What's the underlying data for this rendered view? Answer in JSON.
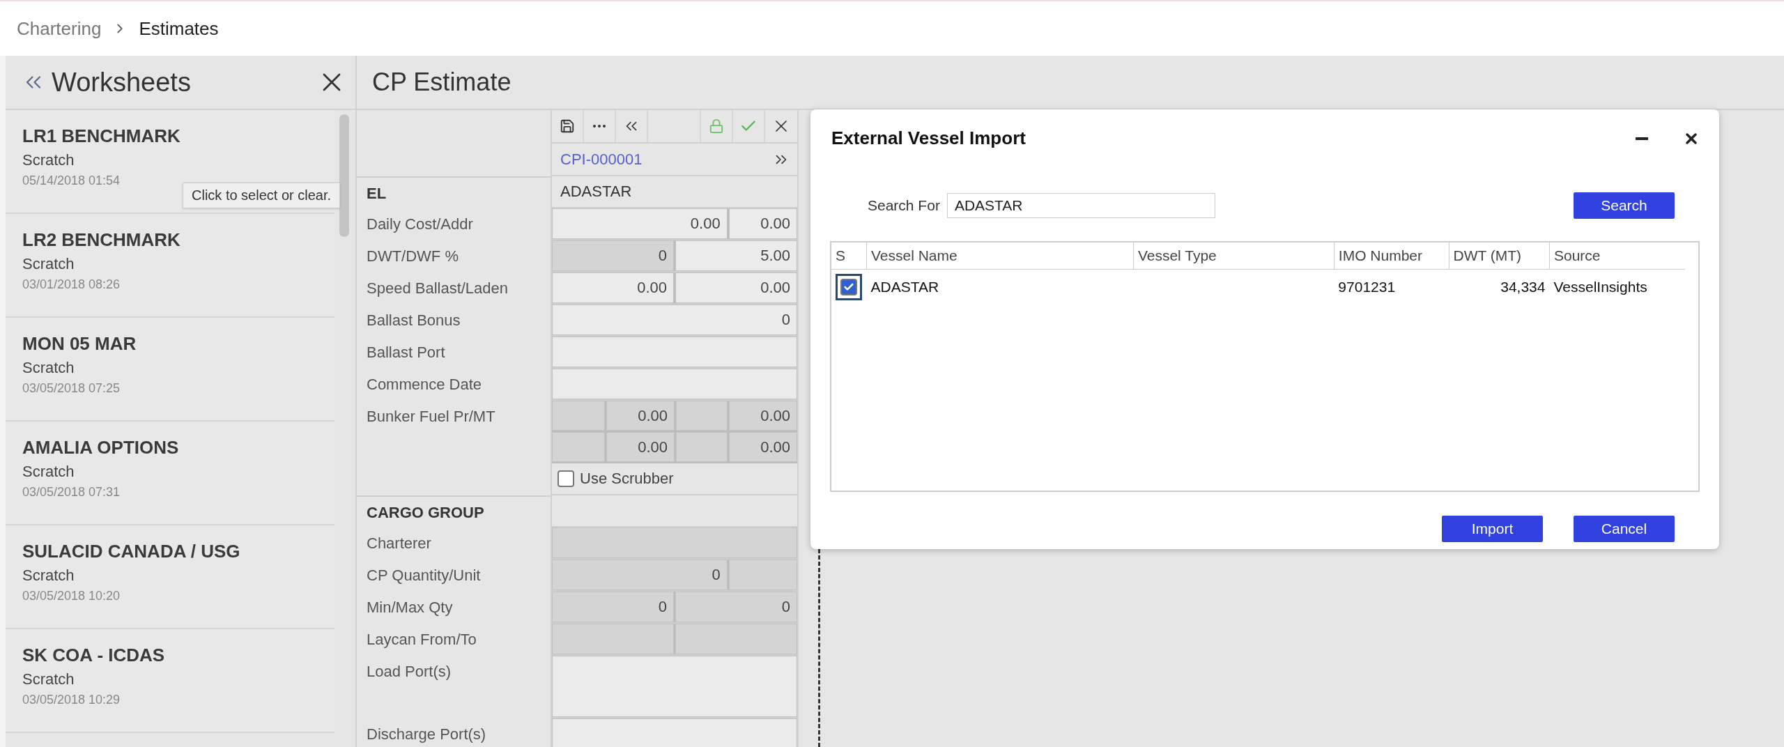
{
  "breadcrumb": [
    {
      "label": "Chartering",
      "current": false
    },
    {
      "label": "Estimates",
      "current": true
    }
  ],
  "sidebar": {
    "title": "Worksheets",
    "items": [
      {
        "name": "LR1 BENCHMARK",
        "type": "Scratch",
        "date": "05/14/2018 01:54"
      },
      {
        "name": "LR2 BENCHMARK",
        "type": "Scratch",
        "date": "03/01/2018 08:26"
      },
      {
        "name": "MON 05 MAR",
        "type": "Scratch",
        "date": "03/05/2018 07:25"
      },
      {
        "name": "AMALIA OPTIONS",
        "type": "Scratch",
        "date": "03/05/2018 07:31"
      },
      {
        "name": "SULACID CANADA / USG",
        "type": "Scratch",
        "date": "03/05/2018 10:20"
      },
      {
        "name": "SK COA - ICDAS",
        "type": "Scratch",
        "date": "03/05/2018 10:29"
      }
    ]
  },
  "tooltip": "Click to select or clear.",
  "estimate": {
    "title": "CP Estimate",
    "record_id": "CPI-000001",
    "sections": [
      {
        "title": "EL",
        "value": "ADASTAR",
        "rows": [
          {
            "label": "Daily Cost/Addr",
            "kind": "wide-narrow",
            "cells": [
              {
                "value": "0.00",
                "shaded": false
              },
              {
                "value": "0.00",
                "shaded": false
              }
            ]
          },
          {
            "label": "DWT/DWF %",
            "kind": "split",
            "cells": [
              {
                "value": "0",
                "shaded": true
              },
              {
                "value": "5.00",
                "shaded": false
              }
            ]
          },
          {
            "label": "Speed Ballast/Laden",
            "kind": "split",
            "cells": [
              {
                "value": "0.00",
                "shaded": false
              },
              {
                "value": "0.00",
                "shaded": false
              }
            ]
          },
          {
            "label": "Ballast Bonus",
            "kind": "single",
            "cells": [
              {
                "value": "0",
                "shaded": false
              }
            ]
          },
          {
            "label": "Ballast Port",
            "kind": "single",
            "cells": [
              {
                "shaded": false
              }
            ]
          },
          {
            "label": "Commence Date",
            "kind": "single",
            "cells": [
              {
                "shaded": false
              }
            ]
          },
          {
            "label": "Bunker Fuel Pr/MT",
            "kind": "quad",
            "cells": [
              {
                "shaded": true
              },
              {
                "value": "0.00",
                "shaded": true
              },
              {
                "shaded": true
              },
              {
                "value": "0.00",
                "shaded": true
              },
              {
                "shaded": true
              },
              {
                "value": "0.00",
                "shaded": true
              },
              {
                "shaded": true
              },
              {
                "value": "0.00",
                "shaded": true
              }
            ]
          },
          {
            "kind": "checkbox",
            "option": "Use Scrubber",
            "checked": false
          }
        ]
      },
      {
        "title": "CARGO GROUP",
        "rows": [
          {
            "label": "Charterer",
            "kind": "single",
            "cells": [
              {
                "shaded": true
              }
            ]
          },
          {
            "label": "CP Quantity/Unit",
            "kind": "wide-narrow",
            "cells": [
              {
                "value": "0",
                "shaded": true
              },
              {
                "shaded": true
              }
            ]
          },
          {
            "label": "Min/Max Qty",
            "kind": "split",
            "cells": [
              {
                "value": "0",
                "shaded": true
              },
              {
                "value": "0",
                "shaded": true
              }
            ]
          },
          {
            "label": "Laycan From/To",
            "kind": "split",
            "cells": [
              {
                "shaded": true
              },
              {
                "shaded": true
              }
            ]
          },
          {
            "label": "Load Port(s)",
            "kind": "tall",
            "cells": [
              {
                "shaded": false
              }
            ]
          },
          {
            "label": "Discharge Port(s)",
            "kind": "single",
            "cells": [
              {
                "shaded": false
              }
            ]
          }
        ]
      }
    ]
  },
  "dialog": {
    "title": "External Vessel Import",
    "search_label": "Search For",
    "search_value": "ADASTAR",
    "search_button": "Search",
    "columns": [
      {
        "label": "S"
      },
      {
        "label": "Vessel Name"
      },
      {
        "label": "Vessel Type"
      },
      {
        "label": "IMO Number"
      },
      {
        "label": "DWT (MT)"
      },
      {
        "label": "Source"
      }
    ],
    "rows": [
      {
        "checked": true,
        "vessel_name": "ADASTAR",
        "imo_number": "9701231",
        "dwt": "34,334",
        "source": "VesselInsights"
      }
    ],
    "buttons": [
      "Import",
      "Cancel"
    ]
  }
}
